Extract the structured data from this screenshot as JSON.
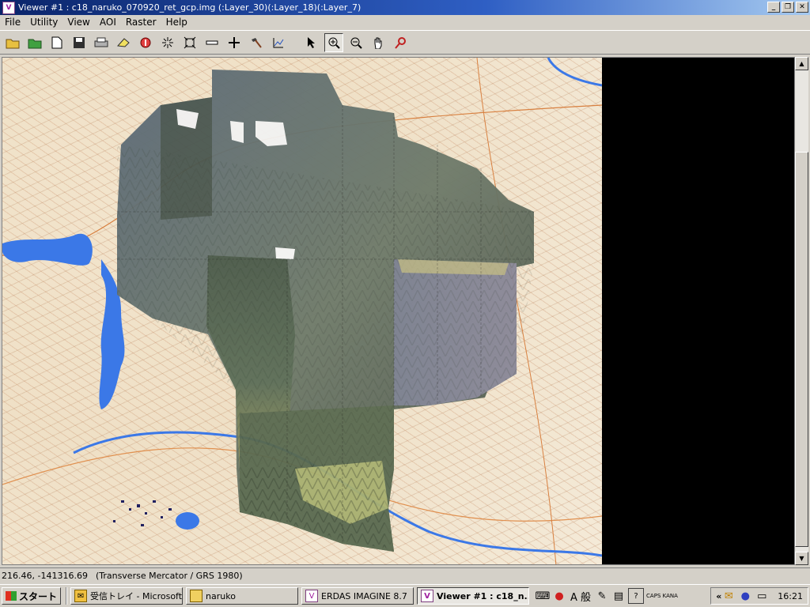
{
  "window": {
    "title": "Viewer #1 : c18_naruko_070920_ret_gcp.img (:Layer_30)(:Layer_18)(:Layer_7)",
    "minimize": "_",
    "maximize": "❐",
    "close": "✕"
  },
  "menu": {
    "file": "File",
    "utility": "Utility",
    "view": "View",
    "aoi": "AOI",
    "raster": "Raster",
    "help": "Help"
  },
  "toolbar": {
    "icons": [
      "open-icon",
      "open-layer-icon",
      "new-icon",
      "save-icon",
      "print-icon",
      "eraser-icon",
      "info-icon",
      "zoom-in-extent-icon",
      "fit-icon",
      "measure-icon",
      "crosshair-icon",
      "hammer-icon",
      "profile-icon",
      "select-arrow-icon",
      "zoom-in-icon",
      "zoom-out-icon",
      "pan-hand-icon",
      "inquire-icon"
    ],
    "pressed": "zoom-in-icon"
  },
  "status": {
    "coords": "216.46, -141316.69",
    "projection": "(Transverse Mercator / GRS 1980)"
  },
  "taskbar": {
    "start": "スタート",
    "tasks": [
      {
        "label": "受信トレイ - Microsoft ..."
      },
      {
        "label": "naruko"
      },
      {
        "label": "ERDAS IMAGINE 8.7"
      },
      {
        "label": "Viewer #1 : c18_n..."
      }
    ],
    "ime_mode": "A 般",
    "caps": "CAPS KANA",
    "expand": "«",
    "clock": "16:21"
  },
  "colors": {
    "title_active": "#0a246a",
    "water": "#3b78e7",
    "viewer_background": "#000000"
  }
}
